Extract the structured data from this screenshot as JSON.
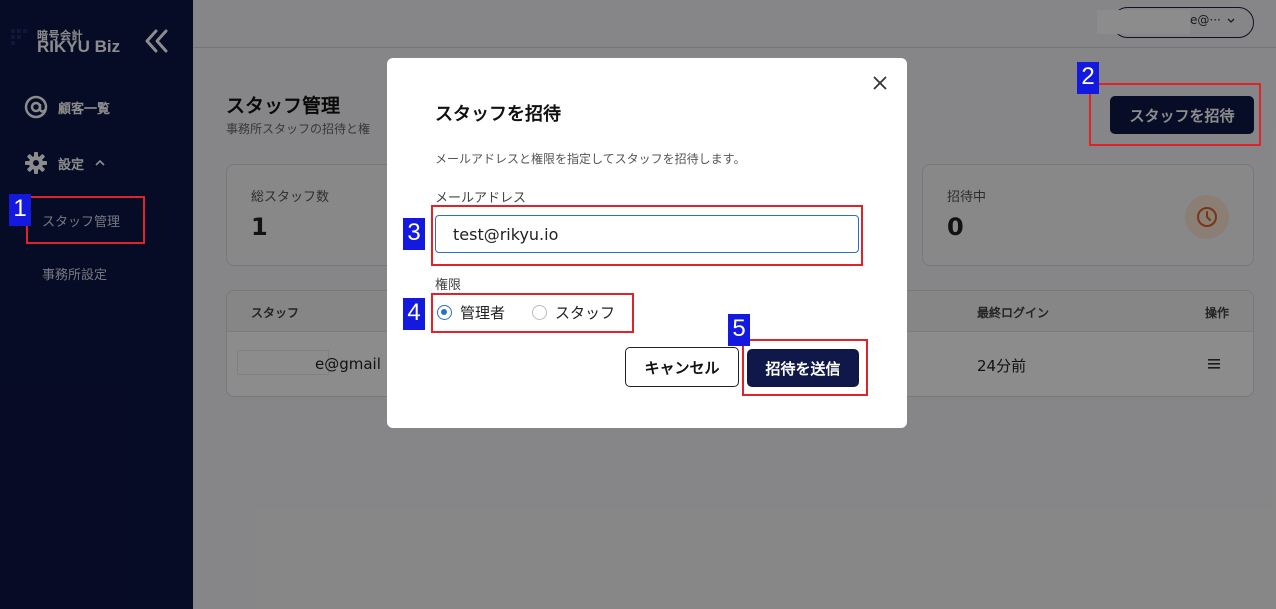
{
  "sidebar": {
    "logo_small": "暗号会計",
    "logo_big": "RIKYU Biz",
    "nav_customers": "顧客一覧",
    "nav_settings": "設定",
    "nav_staff": "スタッフ管理",
    "nav_office": "事務所設定"
  },
  "header": {
    "user_email_suffix": "e@···"
  },
  "main": {
    "title": "スタッフ管理",
    "description": "事務所スタッフの招待と権",
    "invite_button": "スタッフを招待",
    "cards": {
      "total_label": "総スタッフ数",
      "total_value": "1",
      "invited_label": "招待中",
      "invited_value": "0"
    },
    "table": {
      "col_staff": "スタッフ",
      "col_last_login": "最終ログイン",
      "col_ops": "操作",
      "rows": [
        {
          "email_suffix": "e@gmail",
          "last_login": "24分前"
        }
      ]
    }
  },
  "modal": {
    "title": "スタッフを招待",
    "description": "メールアドレスと権限を指定してスタッフを招待します。",
    "email_label": "メールアドレス",
    "email_value": "test@rikyu.io",
    "role_label": "権限",
    "role_admin": "管理者",
    "role_staff": "スタッフ",
    "selected_role": "admin",
    "cancel_button": "キャンセル",
    "send_button": "招待を送信"
  },
  "annotations": [
    "1",
    "2",
    "3",
    "4",
    "5"
  ],
  "colors": {
    "sidebar_bg": "#0c1445",
    "primary_button": "#0f1848",
    "accent_blue": "#2a6fc9",
    "annotation_red": "#e0232b",
    "annotation_blue": "#1419e0"
  }
}
